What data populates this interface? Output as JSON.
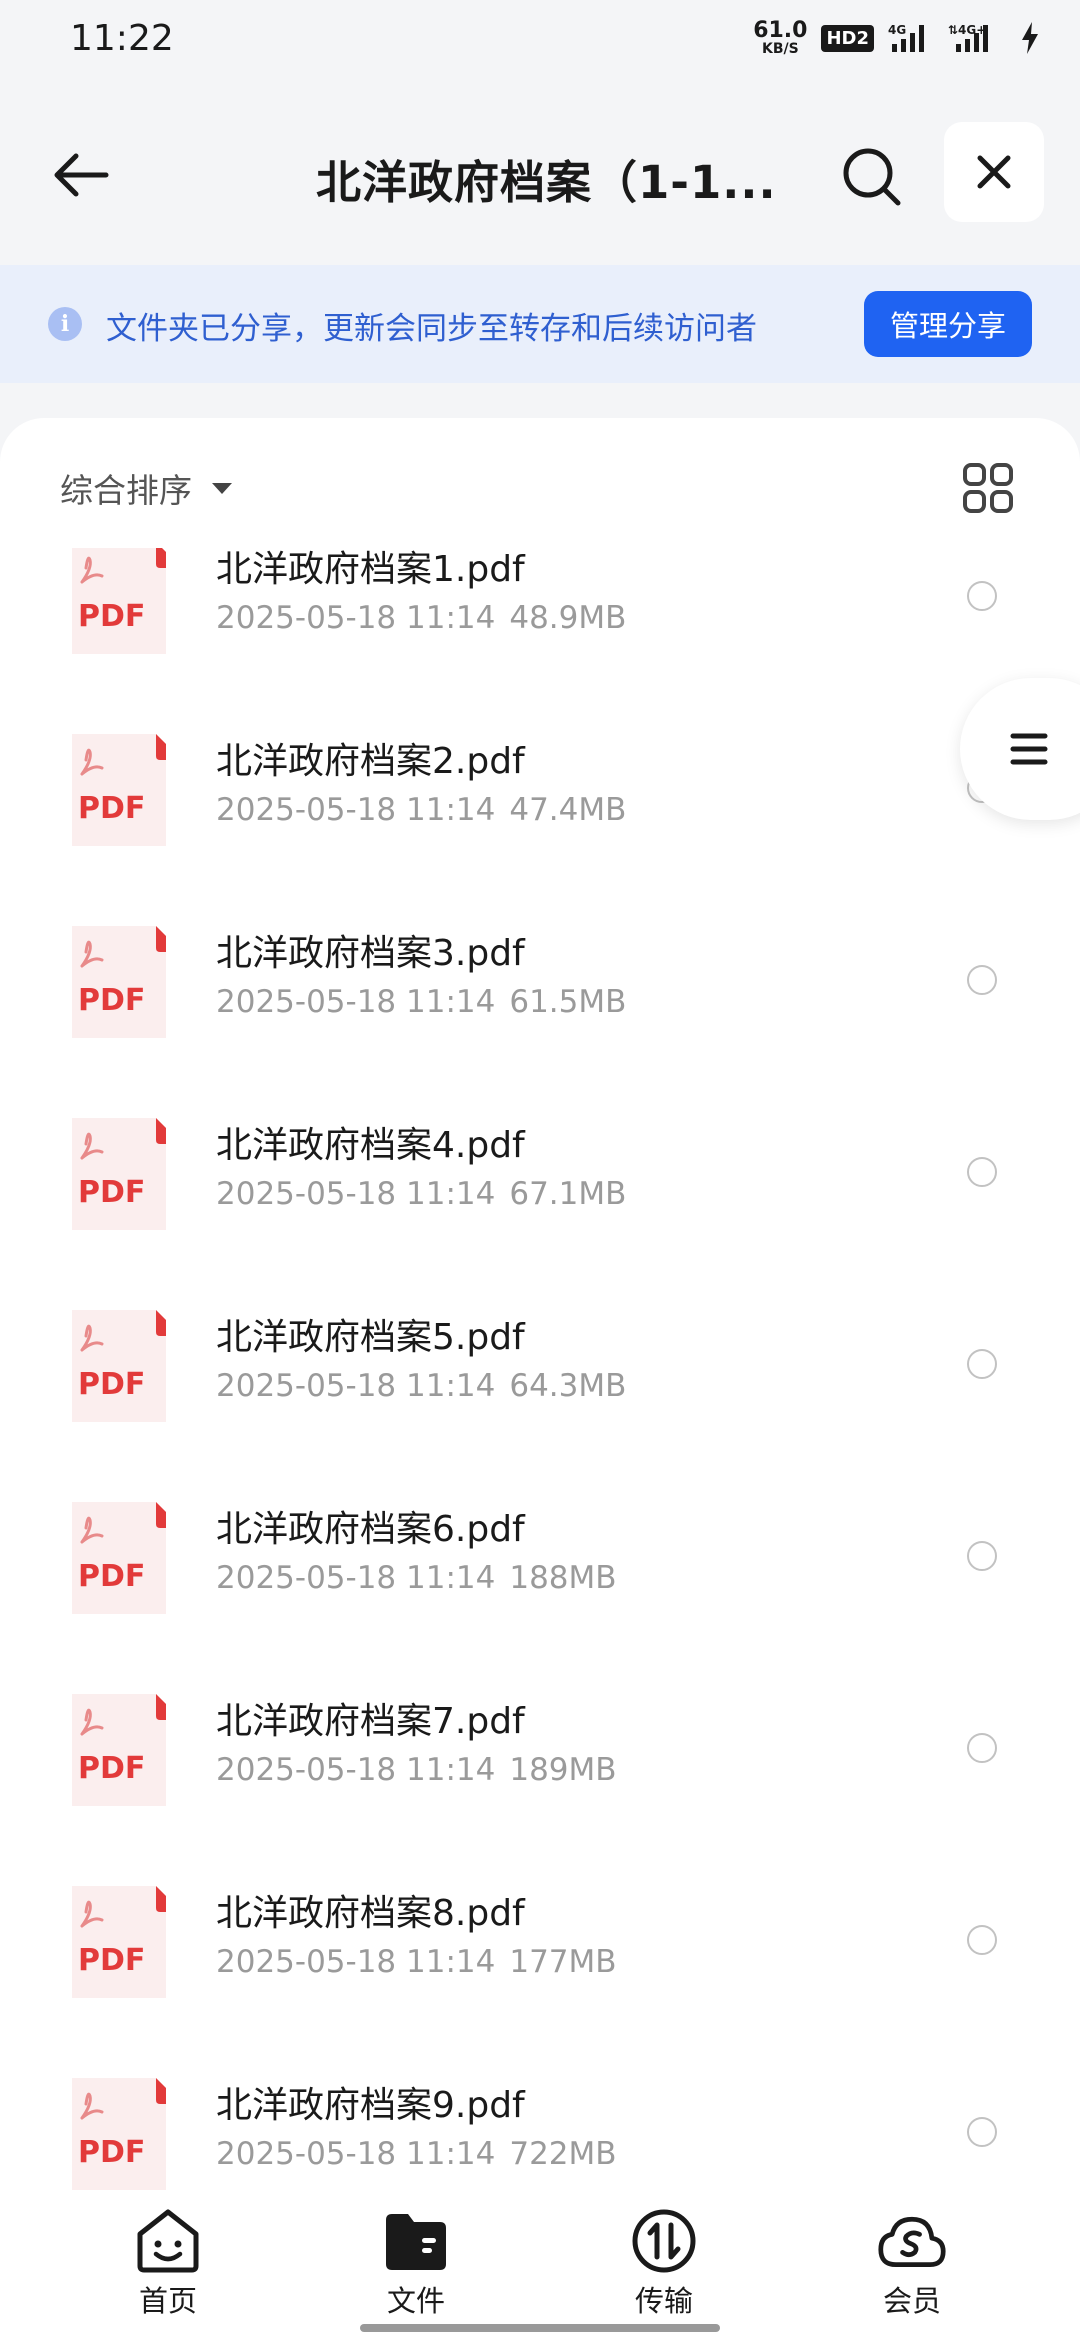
{
  "status_bar": {
    "time": "11:22",
    "net_speed_value": "61.0",
    "net_speed_unit": "KB/S",
    "hd_badge": "HD2",
    "icons": [
      "network-speed-indicator",
      "hd-voice-icon",
      "signal-4g-icon",
      "signal-4g-plus-icon",
      "charging-icon"
    ]
  },
  "header": {
    "title": "北洋政府档案（1-1...",
    "back_icon": "back-arrow-icon",
    "search_icon": "search-icon",
    "close_icon": "close-icon"
  },
  "notice": {
    "text": "文件夹已分享，更新会同步至转存和后续访问者",
    "button_label": "管理分享",
    "icon": "info-icon",
    "icon_glyph": "i"
  },
  "sort": {
    "label": "综合排序",
    "grid_icon": "grid-view-icon"
  },
  "file_icon": {
    "type_label": "PDF",
    "color": "#e23a3a"
  },
  "files": [
    {
      "name": "北洋政府档案1.pdf",
      "date": "2025-05-18 11:14",
      "size": "48.9MB"
    },
    {
      "name": "北洋政府档案2.pdf",
      "date": "2025-05-18 11:14",
      "size": "47.4MB"
    },
    {
      "name": "北洋政府档案3.pdf",
      "date": "2025-05-18 11:14",
      "size": "61.5MB"
    },
    {
      "name": "北洋政府档案4.pdf",
      "date": "2025-05-18 11:14",
      "size": "67.1MB"
    },
    {
      "name": "北洋政府档案5.pdf",
      "date": "2025-05-18 11:14",
      "size": "64.3MB"
    },
    {
      "name": "北洋政府档案6.pdf",
      "date": "2025-05-18 11:14",
      "size": "188MB"
    },
    {
      "name": "北洋政府档案7.pdf",
      "date": "2025-05-18 11:14",
      "size": "189MB"
    },
    {
      "name": "北洋政府档案8.pdf",
      "date": "2025-05-18 11:14",
      "size": "177MB"
    },
    {
      "name": "北洋政府档案9.pdf",
      "date": "2025-05-18 11:14",
      "size": "722MB"
    }
  ],
  "side_menu": {
    "icon": "menu-icon"
  },
  "bottom_nav": [
    {
      "label": "首页",
      "icon": "home-face-icon",
      "active": false
    },
    {
      "label": "文件",
      "icon": "folder-icon",
      "active": true
    },
    {
      "label": "传输",
      "icon": "transfer-icon",
      "active": false
    },
    {
      "label": "会员",
      "icon": "vip-cloud-icon",
      "active": false
    }
  ],
  "colors": {
    "accent": "#1f63f2",
    "notice_bg": "#e9effb",
    "notice_text": "#2f5fd0",
    "pdf_red": "#e23a3a",
    "meta_gray": "#9a9a9a"
  }
}
